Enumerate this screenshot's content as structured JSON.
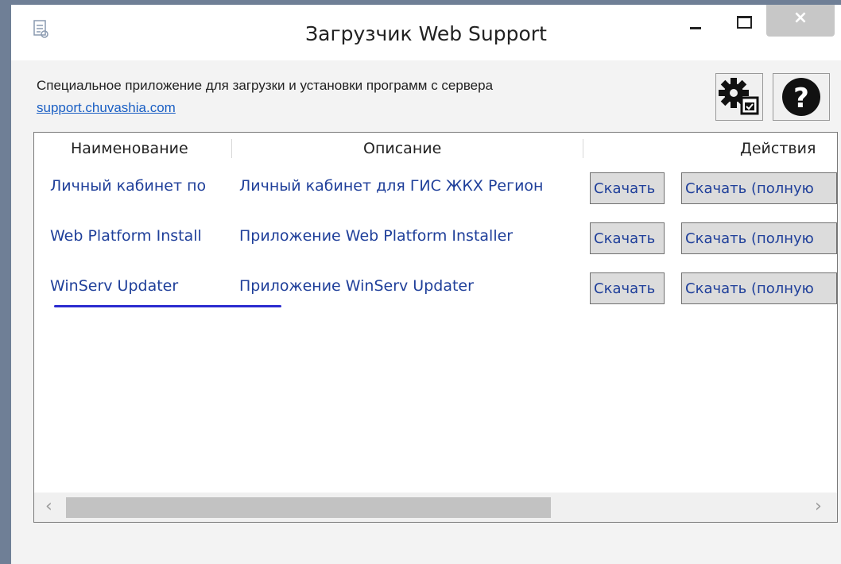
{
  "window": {
    "title": "Загрузчик Web Support",
    "close_label": "×"
  },
  "info": {
    "description": "Специальное приложение для загрузки и установки программ с сервера",
    "link": "support.chuvashia.com"
  },
  "grid": {
    "columns": [
      "Наименование",
      "Описание",
      "Действия"
    ],
    "rows": [
      {
        "name": "Личный кабинет по",
        "description": "Личный кабинет для ГИС ЖКХ Регион",
        "action1": "Скачать",
        "action2": "Скачать (полную"
      },
      {
        "name": "Web Platform Install",
        "description": "Приложение Web Platform Installer",
        "action1": "Скачать",
        "action2": "Скачать (полную"
      },
      {
        "name": "WinServ Updater",
        "description": "Приложение WinServ Updater",
        "action1": "Скачать",
        "action2": "Скачать (полную"
      }
    ],
    "scroll_left": "‹",
    "scroll_right": "›"
  },
  "icons": [
    "app-icon",
    "settings-gear-icon",
    "help-icon"
  ],
  "colors": {
    "link": "#1a5fc4",
    "cell_text": "#1f3f9a",
    "annotation": "#2b2bd0"
  }
}
